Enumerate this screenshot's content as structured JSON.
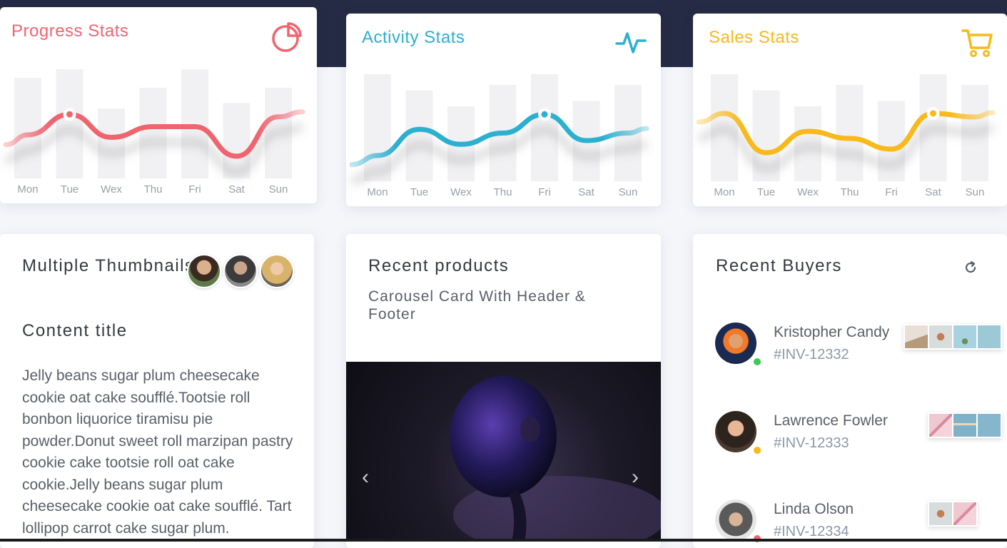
{
  "colors": {
    "top_band": "#262b45",
    "progress": "#f0646e",
    "activity": "#2bb0d0",
    "sales": "#f8b91a",
    "bar": "#f1f1f4",
    "online": "#3ec95a",
    "away": "#f8b91a",
    "busy": "#f0646e"
  },
  "stats": {
    "progress": {
      "title": "Progress Stats",
      "icon": "pie-chart-icon"
    },
    "activity": {
      "title": "Activity Stats",
      "icon": "activity-pulse-icon"
    },
    "sales": {
      "title": "Sales Stats",
      "icon": "shopping-cart-icon"
    }
  },
  "chart_data": [
    {
      "type": "bar",
      "title": "Progress Stats",
      "categories": [
        "Mon",
        "Tue",
        "Wex",
        "Thu",
        "Fri",
        "Sat",
        "Sun"
      ],
      "bars": [
        92,
        100,
        64,
        83,
        100,
        69,
        83
      ],
      "line": [
        40,
        65,
        37,
        50,
        50,
        14,
        62
      ]
    },
    {
      "type": "bar",
      "title": "Activity Stats",
      "categories": [
        "Mon",
        "Tue",
        "Wex",
        "Thu",
        "Fri",
        "Sat",
        "Sun"
      ],
      "bars": [
        100,
        85,
        70,
        90,
        100,
        75,
        90
      ],
      "line": [
        20,
        55,
        35,
        50,
        75,
        40,
        50
      ]
    },
    {
      "type": "bar",
      "title": "Sales Stats",
      "categories": [
        "Mon",
        "Tue",
        "Wex",
        "Thu",
        "Fri",
        "Sat",
        "Sun"
      ],
      "bars": [
        100,
        85,
        70,
        90,
        75,
        100,
        90
      ],
      "line": [
        75,
        20,
        50,
        40,
        25,
        75,
        70
      ]
    }
  ],
  "thumbnails_card": {
    "title": "Multiple Thumbnails",
    "content_title": "Content title",
    "body": "Jelly beans sugar plum cheesecake cookie oat cake soufflé.Tootsie roll bonbon liquorice tiramisu pie powder.Donut sweet roll marzipan pastry cookie cake tootsie roll oat cake cookie.Jelly beans sugar plum cheesecake cookie oat cake soufflé. Tart lollipop carrot cake sugar plum."
  },
  "products_card": {
    "title": "Recent products",
    "subtitle": "Carousel Card With Header & Footer",
    "prev_icon": "chevron-left-icon",
    "next_icon": "chevron-right-icon"
  },
  "buyers_card": {
    "title": "Recent Buyers",
    "refresh_icon": "refresh-icon",
    "buyers": [
      {
        "name": "Kristopher Candy",
        "invoice": "#INV-12332",
        "status": "online"
      },
      {
        "name": "Lawrence Fowler",
        "invoice": "#INV-12333",
        "status": "away"
      },
      {
        "name": "Linda Olson",
        "invoice": "#INV-12334",
        "status": "busy"
      }
    ]
  }
}
